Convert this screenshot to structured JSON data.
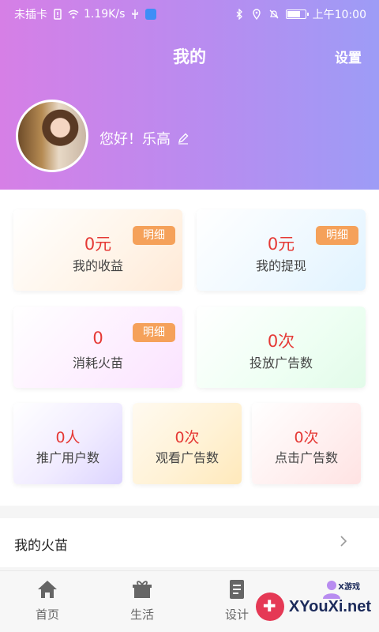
{
  "status_bar": {
    "left_text": "未插卡",
    "speed": "1.19K/s",
    "time": "上午10:00"
  },
  "header": {
    "title": "我的",
    "settings_label": "设置",
    "greeting": "您好！乐高"
  },
  "cards": [
    {
      "value": "0元",
      "label": "我的收益",
      "badge": "明细"
    },
    {
      "value": "0元",
      "label": "我的提现",
      "badge": "明细"
    },
    {
      "value": "0",
      "label": "消耗火苗",
      "badge": "明细"
    },
    {
      "value": "0次",
      "label": "投放广告数"
    }
  ],
  "small_cards": [
    {
      "value": "0人",
      "label": "推广用户数"
    },
    {
      "value": "0次",
      "label": "观看广告数"
    },
    {
      "value": "0次",
      "label": "点击广告数"
    }
  ],
  "menu_row": {
    "label": "我的火苗"
  },
  "tabbar": [
    {
      "label": "首页",
      "icon": "home-icon"
    },
    {
      "label": "生活",
      "icon": "gift-icon"
    },
    {
      "label": "设计",
      "icon": "document-icon"
    },
    {
      "label": "",
      "icon": "profile-icon"
    }
  ],
  "watermark": {
    "brand": "XYouXi.net",
    "small": "X游戏"
  },
  "colors": {
    "accent_red": "#e53935",
    "badge_orange": "#f5a15a",
    "header_start": "#d67fe6",
    "header_end": "#9d9cf6"
  }
}
